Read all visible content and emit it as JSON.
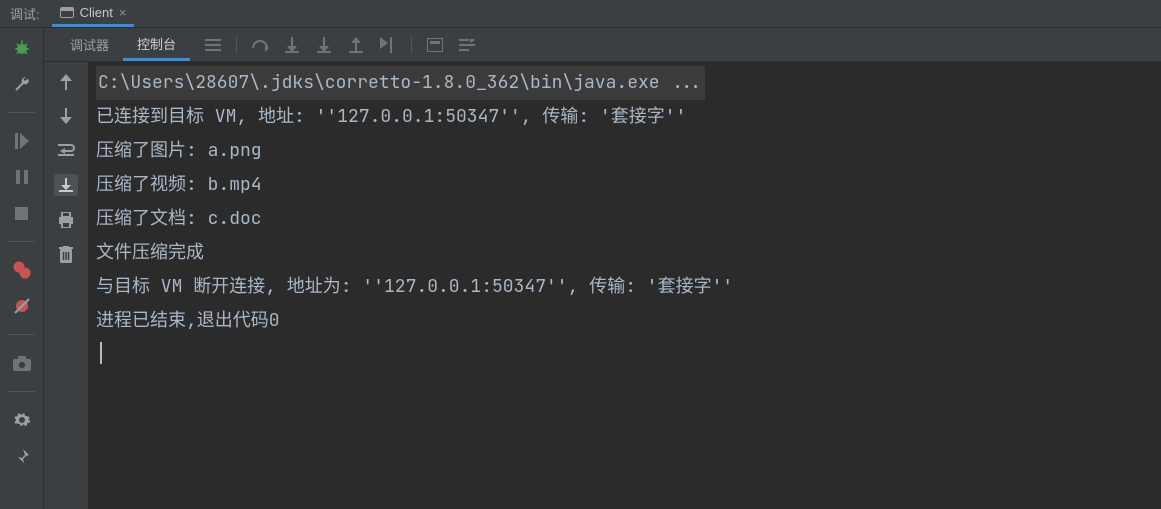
{
  "header": {
    "label": "调试:",
    "run_config": "Client"
  },
  "tabs": {
    "debugger": "调试器",
    "console": "控制台"
  },
  "console": {
    "command": "C:\\Users\\28607\\.jdks\\corretto-1.8.0_362\\bin\\java.exe ...",
    "lines": [
      "已连接到目标 VM, 地址: ''127.0.0.1:50347'', 传输: '套接字''",
      "压缩了图片: a.png",
      "压缩了视频: b.mp4",
      "压缩了文档: c.doc",
      "文件压缩完成",
      "与目标 VM 断开连接, 地址为: ''127.0.0.1:50347'', 传输: '套接字''",
      "",
      "进程已结束,退出代码0"
    ]
  }
}
